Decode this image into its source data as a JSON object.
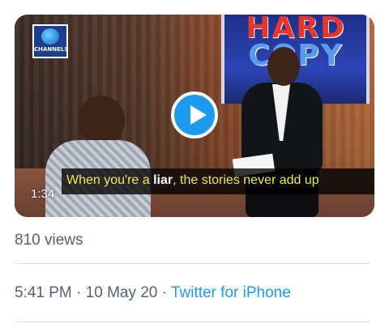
{
  "video": {
    "channel_logo_text": "CHANNELS",
    "studio_backdrop_text": [
      "HARD",
      "COPY"
    ],
    "caption_before": "When you're a ",
    "caption_emphasis": "liar",
    "caption_after": ", the stories never add up",
    "duration": "1:34",
    "play_icon": "play-icon",
    "accent_color": "#1d9bf0"
  },
  "stats": {
    "views": "810 views"
  },
  "meta": {
    "time": "5:41 PM",
    "separator": " · ",
    "date": "10 May 20",
    "source": "Twitter for iPhone"
  }
}
